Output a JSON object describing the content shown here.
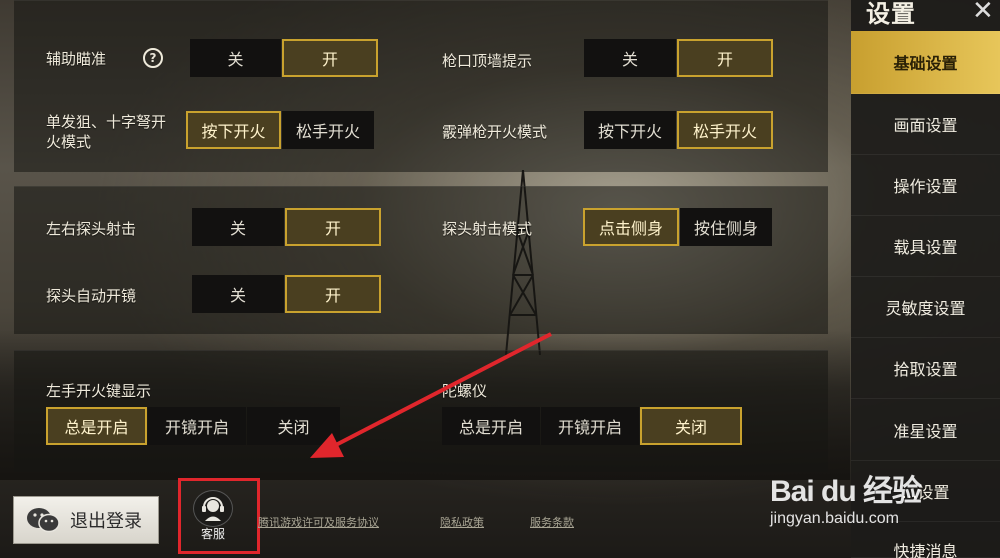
{
  "sidebar": {
    "title": "设置",
    "items": [
      {
        "label": "基础设置",
        "active": true
      },
      {
        "label": "画面设置"
      },
      {
        "label": "操作设置"
      },
      {
        "label": "载具设置"
      },
      {
        "label": "灵敏度设置"
      },
      {
        "label": "拾取设置"
      },
      {
        "label": "准星设置"
      },
      {
        "label": "…设置"
      },
      {
        "label": "快捷消息"
      }
    ]
  },
  "settings": {
    "aim_assist": {
      "label": "辅助瞄准",
      "options": [
        "关",
        "开"
      ],
      "selected": "开"
    },
    "muzzle_wall": {
      "label": "枪口顶墙提示",
      "options": [
        "关",
        "开"
      ],
      "selected": "开"
    },
    "sniper_fire": {
      "label": "单发狙、十字弩开火模式",
      "options": [
        "按下开火",
        "松手开火"
      ],
      "selected": "按下开火"
    },
    "shotgun_fire": {
      "label": "霰弹枪开火模式",
      "options": [
        "按下开火",
        "松手开火"
      ],
      "selected": "松手开火"
    },
    "peek_fire": {
      "label": "左右探头射击",
      "options": [
        "关",
        "开"
      ],
      "selected": "开"
    },
    "peek_mode": {
      "label": "探头射击模式",
      "options": [
        "点击侧身",
        "按住侧身"
      ],
      "selected": "点击侧身"
    },
    "peek_scope": {
      "label": "探头自动开镜",
      "options": [
        "关",
        "开"
      ],
      "selected": "开"
    },
    "left_fire": {
      "label": "左手开火键显示",
      "options": [
        "总是开启",
        "开镜开启",
        "关闭"
      ],
      "selected": "总是开启"
    },
    "gyro": {
      "label": "陀螺仪",
      "options": [
        "总是开启",
        "开镜开启",
        "关闭"
      ],
      "selected": "关闭"
    }
  },
  "footer": {
    "logout": "退出登录",
    "customer_service": "客服",
    "links": [
      "腾讯游戏许可及服务协议",
      "隐私政策",
      "服务条款"
    ]
  },
  "watermark": {
    "brand": "Bai du 经验",
    "url": "jingyan.baidu.com"
  },
  "colors": {
    "accent": "#c9a22e",
    "annotation_red": "#e0262c"
  }
}
